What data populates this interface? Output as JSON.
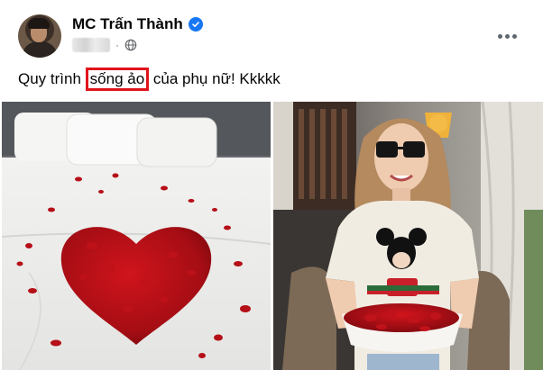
{
  "post": {
    "author": "MC Trấn Thành",
    "meta_separator": "·",
    "caption_before": "Quy trình",
    "caption_highlight": "sống ảo",
    "caption_after": "của phụ nữ! Kkkkk"
  },
  "icons": {
    "verified": "verified-badge-icon",
    "audience": "globe-icon",
    "menu": "more-options-icon"
  },
  "photos": [
    {
      "subject": "bed with rose petal heart"
    },
    {
      "subject": "woman holding bowl of rose petals"
    }
  ],
  "colors": {
    "verified": "#1877f2",
    "highlight_border": "#e0141c",
    "secondary_text": "#65676b"
  }
}
